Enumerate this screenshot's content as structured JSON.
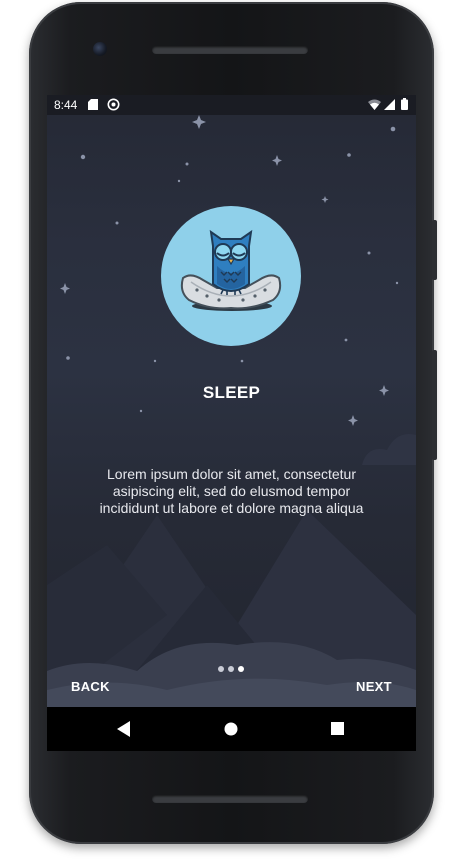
{
  "status_bar": {
    "time": "8:44",
    "left_icons": [
      "sd-card-icon",
      "sync-icon"
    ],
    "right_icons": [
      "wifi-icon",
      "signal-icon",
      "battery-icon"
    ]
  },
  "onboarding": {
    "illustration": "owl-on-pillow-icon",
    "title": "SLEEP",
    "description": "Lorem ipsum dolor sit amet, consectetur asipiscing elit, sed do elusmod tempor incididunt ut labore et dolore magna aliqua",
    "page_indicator": {
      "count": 3,
      "active_index": 2
    },
    "back_label": "BACK",
    "next_label": "NEXT"
  },
  "nav_bar": {
    "buttons": [
      "back-triangle-icon",
      "home-circle-icon",
      "recents-square-icon"
    ]
  },
  "colors": {
    "logo_circle": "#8fd0ea",
    "background_top": "#252935",
    "background_mid": "#2c3242",
    "text": "#ffffff"
  }
}
